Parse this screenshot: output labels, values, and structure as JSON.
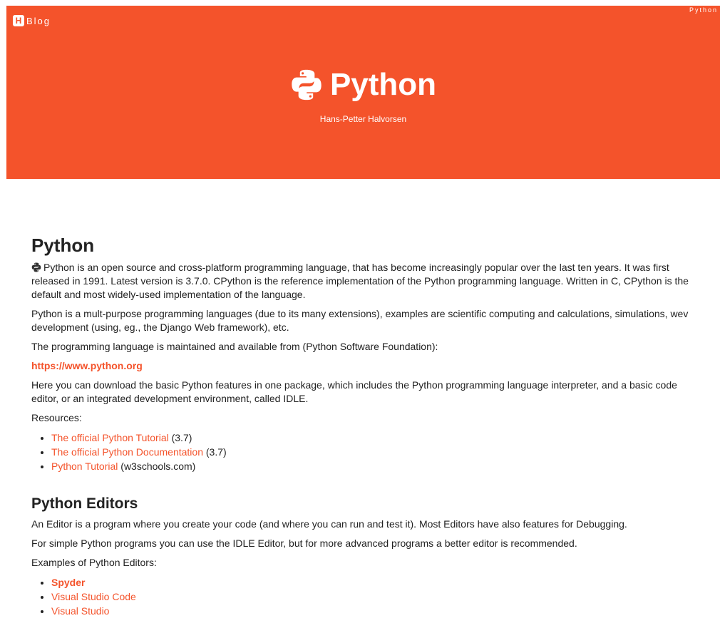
{
  "header": {
    "brand_logo": "H",
    "brand_text": "Blog",
    "nav_link": "Python",
    "title": "Python",
    "subtitle": "Hans-Petter Halvorsen",
    "icon": "python-logo-icon",
    "bg_color": "#f4532b"
  },
  "intro": {
    "heading": "Python",
    "p1": "Python is an open source and cross-platform programming language, that has become increasingly popular over the last ten years. It was first released in 1991. Latest version is 3.7.0. CPython is the reference implementation of the Python programming language. Written in C, CPython is the default and most widely-used implementation of the language.",
    "p2": "Python is a mult-purpose programming languages (due to its many extensions), examples are scientific computing and calculations, simulations, wev development (using, eg., the Django Web framework), etc.",
    "p3": "The programming language is maintained and available from (Python Software Foundation):",
    "link": "https://www.python.org",
    "p4": "Here you can download the basic Python features in one package, which includes the Python programming language interpreter, and a basic code editor, or an integrated development environment, called IDLE.",
    "resources_label": "Resources:",
    "resources": [
      {
        "link": "The official Python Tutorial",
        "note": " (3.7)"
      },
      {
        "link": "The official Python Documentation",
        "note": " (3.7)"
      },
      {
        "link": "Python Tutorial",
        "note": " (w3schools.com)"
      }
    ]
  },
  "editors": {
    "heading": "Python Editors",
    "p1": "An Editor is a program where you create your code (and where you can run and test it). Most Editors have also features for Debugging.",
    "p2": "For simple Python programs you can use the IDLE Editor, but for more advanced programs a better editor is recommended.",
    "examples_label": "Examples of Python Editors:",
    "items": [
      "Spyder",
      "Visual Studio Code",
      "Visual Studio"
    ]
  }
}
